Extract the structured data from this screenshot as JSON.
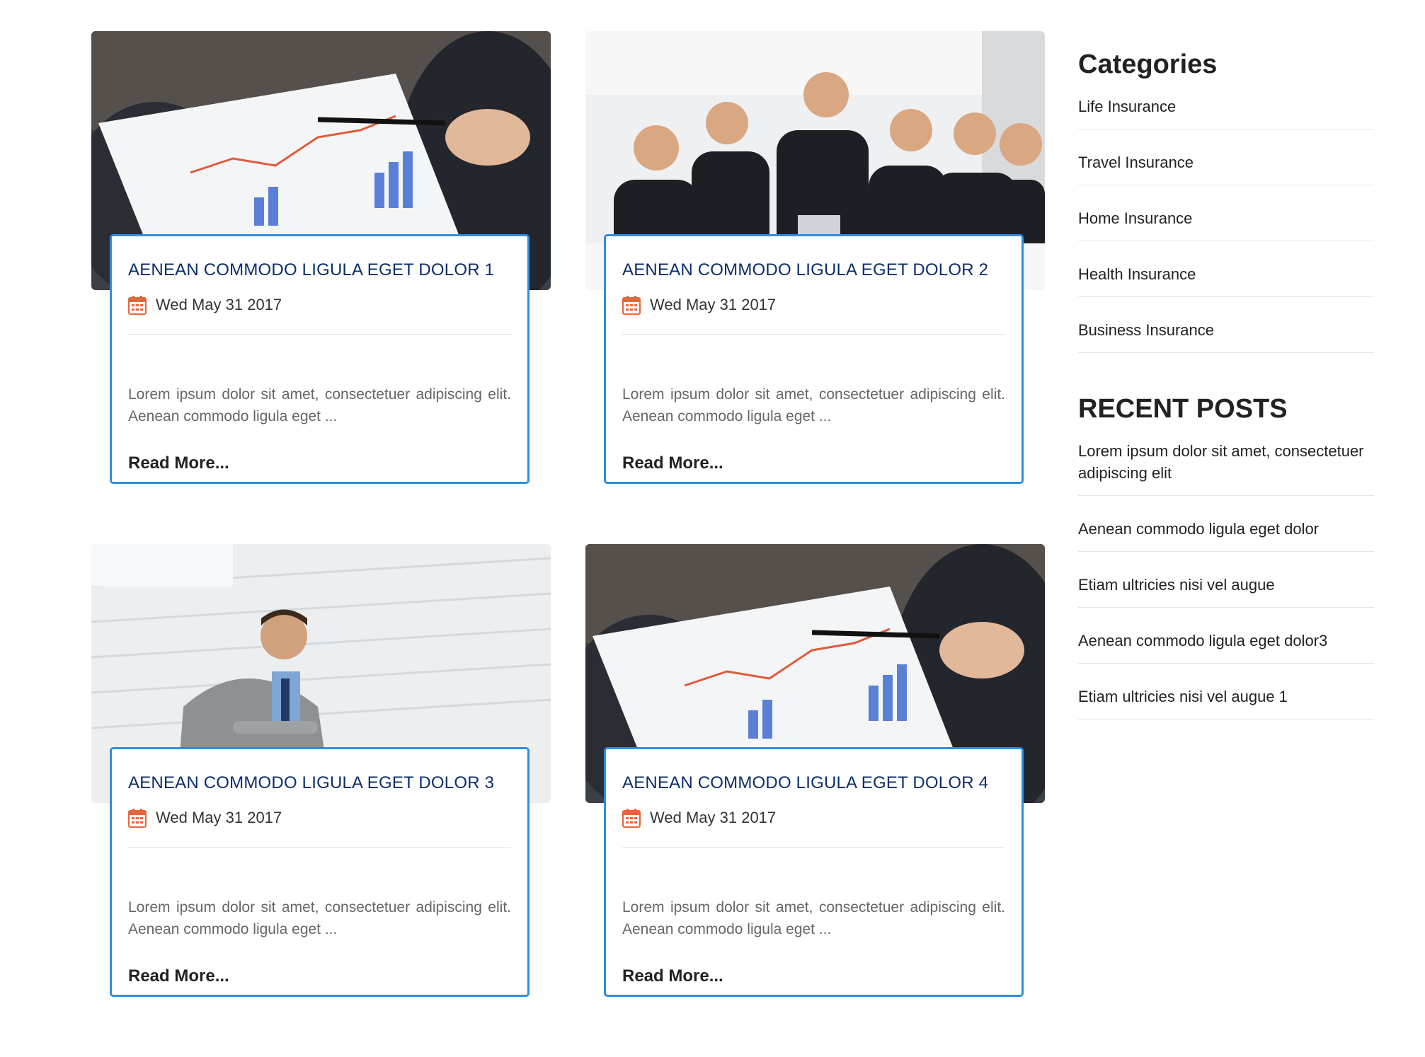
{
  "posts": [
    {
      "title": "AENEAN COMMODO LIGULA EGET DOLOR 1",
      "date": "Wed May 31 2017",
      "excerpt": "Lorem ipsum dolor sit amet, consectetuer adipiscing elit. Aenean commodo ligula eget ...",
      "read_more": "Read More...",
      "image": "business-report-chart-photo"
    },
    {
      "title": "AENEAN COMMODO LIGULA EGET DOLOR 2",
      "date": "Wed May 31 2017",
      "excerpt": "Lorem ipsum dolor sit amet, consectetuer adipiscing elit. Aenean commodo ligula eget ...",
      "read_more": "Read More...",
      "image": "business-team-meeting-photo"
    },
    {
      "title": "AENEAN COMMODO LIGULA EGET DOLOR 3",
      "date": "Wed May 31 2017",
      "excerpt": "Lorem ipsum dolor sit amet, consectetuer adipiscing elit. Aenean commodo ligula eget ...",
      "read_more": "Read More...",
      "image": "businessman-on-stairs-photo"
    },
    {
      "title": "AENEAN COMMODO LIGULA EGET DOLOR 4",
      "date": "Wed May 31 2017",
      "excerpt": "Lorem ipsum dolor sit amet, consectetuer adipiscing elit. Aenean commodo ligula eget ...",
      "read_more": "Read More...",
      "image": "business-report-chart-photo"
    }
  ],
  "sidebar": {
    "categories_heading": "Categories",
    "categories": [
      "Life Insurance",
      "Travel Insurance",
      "Home Insurance",
      "Health Insurance",
      "Business Insurance"
    ],
    "recent_heading": "RECENT POSTS",
    "recent_posts": [
      "Lorem ipsum dolor sit amet, consectetuer adipiscing elit",
      "Aenean commodo ligula eget dolor",
      "Etiam ultricies nisi vel augue",
      "Aenean commodo ligula eget dolor3",
      "Etiam ultricies nisi vel augue 1"
    ]
  },
  "colors": {
    "card_border": "#2e8ee0",
    "title": "#0b2d6b",
    "calendar_icon": "#e8643c"
  },
  "icons": {
    "date": "calendar-icon"
  }
}
